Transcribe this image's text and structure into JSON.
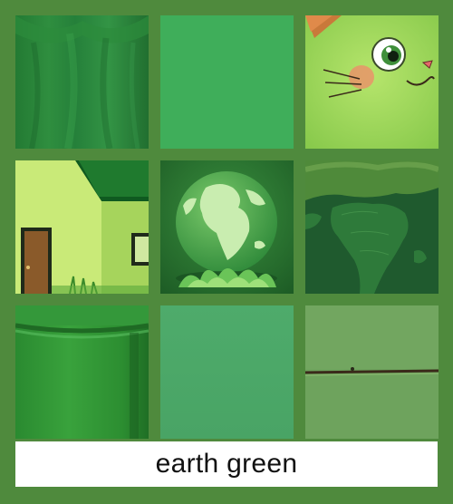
{
  "caption": "earth green",
  "colors": {
    "background": "#4f8a3d",
    "caption_background": "#ffffff",
    "caption_text": "#111111",
    "swatch_primary": "#3fad59",
    "swatch_secondary": "#4fa86a",
    "fabric": "#2f8a3d",
    "cat": "#9fd85a",
    "house_wall": "#b8e36a",
    "globe_background": "#2f7a34",
    "map": "#225a2e",
    "mug": "#2d8a32",
    "wall": "#6aa35a"
  },
  "tiles": [
    {
      "name": "tile-green-fabric",
      "icon": "fabric-drape"
    },
    {
      "name": "tile-green-swatch",
      "icon": "color-swatch"
    },
    {
      "name": "tile-cartoon-cat",
      "icon": "cat-face"
    },
    {
      "name": "tile-cartoon-house",
      "icon": "house"
    },
    {
      "name": "tile-earth-globe",
      "icon": "globe"
    },
    {
      "name": "tile-africa-map",
      "icon": "world-map"
    },
    {
      "name": "tile-green-mug",
      "icon": "mug"
    },
    {
      "name": "tile-green-swatch-2",
      "icon": "color-swatch"
    },
    {
      "name": "tile-green-wall",
      "icon": "painted-wall"
    }
  ]
}
